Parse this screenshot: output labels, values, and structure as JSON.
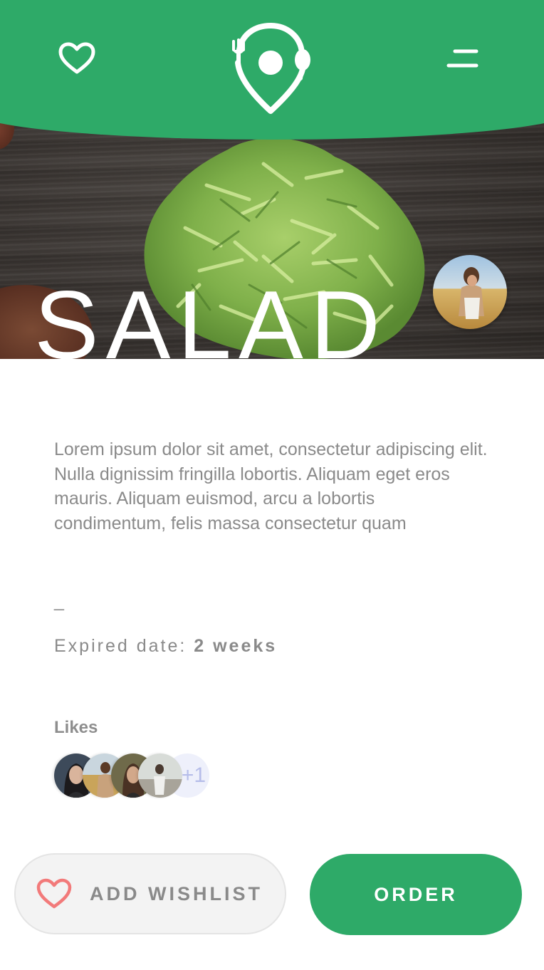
{
  "colors": {
    "brand_green": "#2eaa68",
    "text_gray": "#8a8a8a",
    "wishlist_heart": "#f27a7a"
  },
  "header": {
    "favorites_icon": "heart-outline-icon",
    "logo_icon": "location-pin-fork-spoon-logo",
    "menu_icon": "menu-icon"
  },
  "hero": {
    "title": "SALAD",
    "author_avatar": "user-avatar"
  },
  "product": {
    "description": "Lorem ipsum dolor sit amet, consectetur adipiscing elit. Nulla dignissim fringilla lobortis. Aliquam eget eros mauris. Aliquam euismod, arcu a lobortis condimentum, felis massa consectetur quam",
    "separator": "_",
    "expiry_label": "Expired date: ",
    "expiry_value": "2 weeks"
  },
  "likes": {
    "label": "Likes",
    "more_count": "+1"
  },
  "actions": {
    "wishlist_label": "ADD WISHLIST",
    "wishlist_icon": "heart-outline-icon",
    "order_label": "ORDER"
  }
}
